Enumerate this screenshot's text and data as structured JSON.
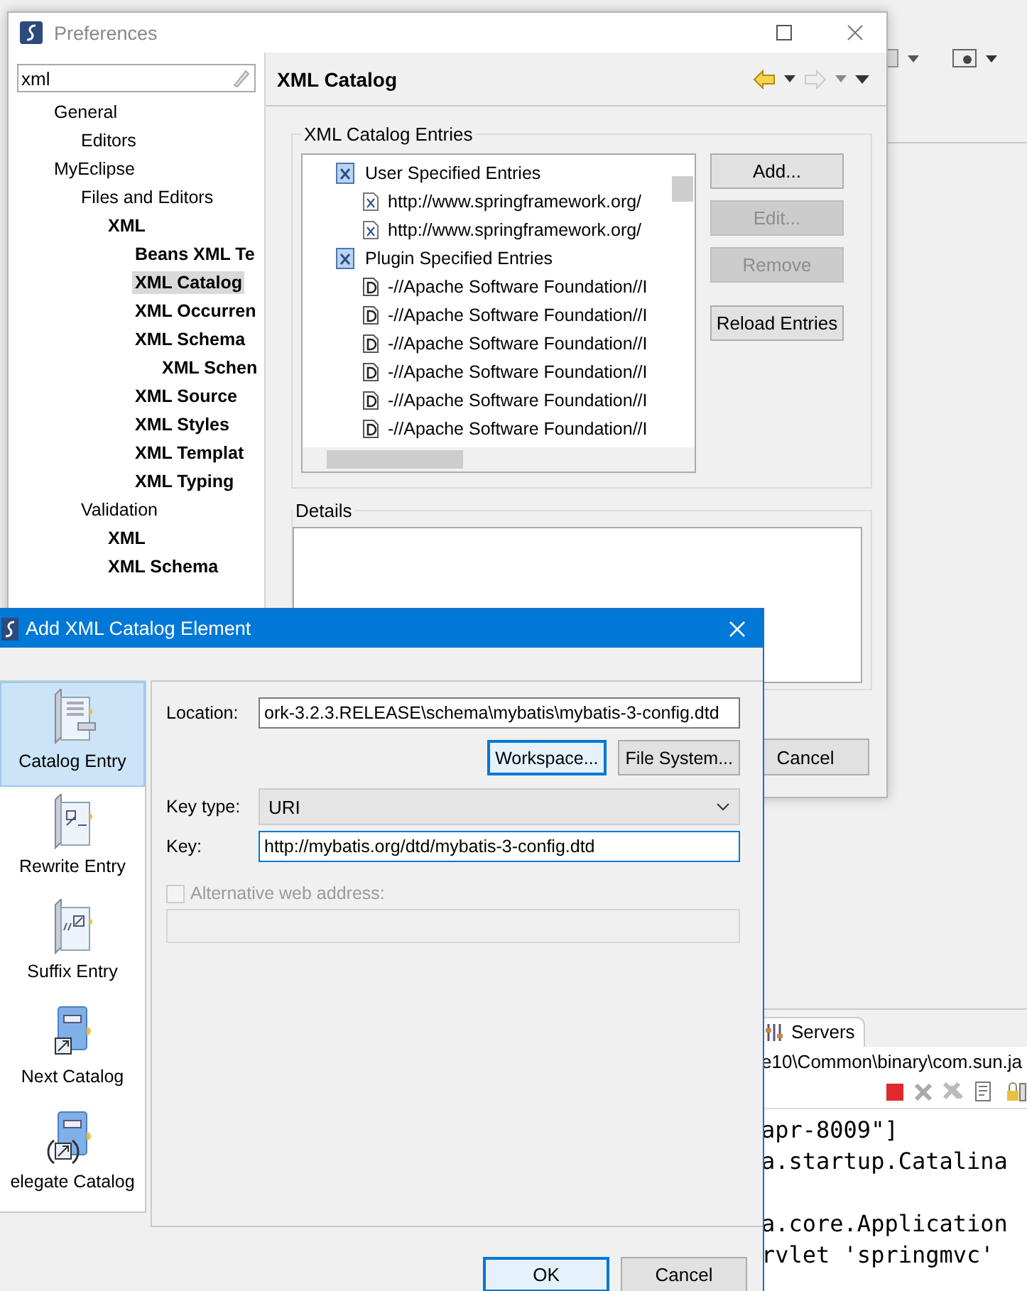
{
  "ide": {
    "servers_tab": "Servers",
    "path": "e10\\Common\\binary\\com.sun.ja",
    "console_lines": [
      "apr-8009\"]",
      "a.startup.Catalina",
      "a.core.Application",
      "rvlet 'springmvc'"
    ]
  },
  "preferences": {
    "title": "Preferences",
    "filter": {
      "value": "xml"
    },
    "tree": [
      {
        "label": "General",
        "bold": false,
        "selected": false,
        "children": [
          {
            "label": "Editors",
            "bold": false,
            "selected": false
          }
        ]
      },
      {
        "label": "MyEclipse",
        "bold": false,
        "selected": false,
        "children": [
          {
            "label": "Files and Editors",
            "bold": false,
            "selected": false,
            "children": [
              {
                "label": "XML",
                "bold": true,
                "selected": false,
                "children": [
                  {
                    "label": "Beans XML Te",
                    "bold": true,
                    "selected": false
                  },
                  {
                    "label": "XML Catalog",
                    "bold": true,
                    "selected": true
                  },
                  {
                    "label": "XML Occurren",
                    "bold": true,
                    "selected": false
                  },
                  {
                    "label": "XML Schema",
                    "bold": true,
                    "selected": false,
                    "children": [
                      {
                        "label": "XML Schen",
                        "bold": true,
                        "selected": false
                      }
                    ]
                  },
                  {
                    "label": "XML Source",
                    "bold": true,
                    "selected": false
                  },
                  {
                    "label": "XML Styles",
                    "bold": true,
                    "selected": false
                  },
                  {
                    "label": "XML Templat",
                    "bold": true,
                    "selected": false
                  },
                  {
                    "label": "XML Typing",
                    "bold": true,
                    "selected": false
                  }
                ]
              }
            ]
          },
          {
            "label": "Validation",
            "bold": false,
            "selected": false,
            "children": [
              {
                "label": "XML",
                "bold": true,
                "selected": false
              },
              {
                "label": "XML Schema",
                "bold": true,
                "selected": false
              }
            ]
          }
        ]
      }
    ],
    "page_title": "XML Catalog",
    "entries": {
      "label": "XML Catalog Entries",
      "tree": [
        {
          "label": "User Specified Entries",
          "kind": "group",
          "children": [
            {
              "label": "http://www.springframework.org/",
              "kind": "uri"
            },
            {
              "label": "http://www.springframework.org/",
              "kind": "uri"
            }
          ]
        },
        {
          "label": "Plugin Specified Entries",
          "kind": "group",
          "children": [
            {
              "label": "-//Apache Software Foundation//I",
              "kind": "dtd"
            },
            {
              "label": "-//Apache Software Foundation//I",
              "kind": "dtd"
            },
            {
              "label": "-//Apache Software Foundation//I",
              "kind": "dtd"
            },
            {
              "label": "-//Apache Software Foundation//I",
              "kind": "dtd"
            },
            {
              "label": "-//Apache Software Foundation//I",
              "kind": "dtd"
            },
            {
              "label": "-//Apache Software Foundation//I",
              "kind": "dtd"
            }
          ]
        }
      ],
      "buttons": [
        {
          "label": "Add...",
          "disabled": false
        },
        {
          "label": "Edit...",
          "disabled": true
        },
        {
          "label": "Remove",
          "disabled": true
        },
        {
          "label": "Reload Entries",
          "disabled": false
        }
      ]
    },
    "details_label": "Details",
    "cancel": "Cancel"
  },
  "dialog": {
    "title": "Add XML Catalog Element",
    "entry_types": [
      {
        "label": "Catalog Entry",
        "kind": "catalog",
        "selected": true
      },
      {
        "label": "Rewrite Entry",
        "kind": "rewrite",
        "selected": false
      },
      {
        "label": "Suffix Entry",
        "kind": "suffix",
        "selected": false
      },
      {
        "label": "Next Catalog",
        "kind": "next",
        "selected": false
      },
      {
        "label": "elegate Catalog",
        "kind": "delegate",
        "selected": false
      }
    ],
    "location_label": "Location:",
    "location": "ork-3.2.3.RELEASE\\schema\\mybatis\\mybatis-3-config.dtd",
    "browse_buttons": [
      "Workspace...",
      "File System..."
    ],
    "key_type_label": "Key type:",
    "key_type": "URI",
    "key_label": "Key:",
    "key": "http://mybatis.org/dtd/mybatis-3-config.dtd",
    "alternative": {
      "label": "Alternative web address:",
      "checked": false,
      "disabled": true
    },
    "ok": "OK",
    "cancel": "Cancel"
  }
}
